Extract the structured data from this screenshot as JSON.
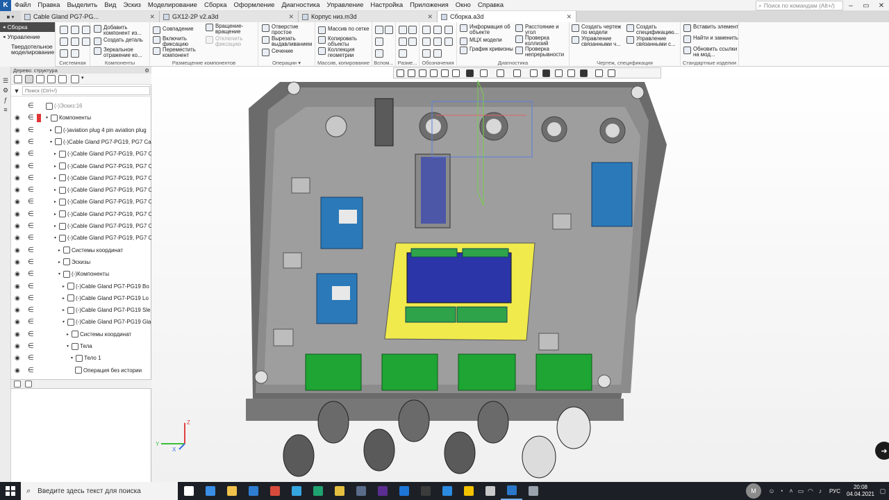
{
  "app": {
    "logo": "K",
    "menu": [
      "Файл",
      "Правка",
      "Выделить",
      "Вид",
      "Эскиз",
      "Моделирование",
      "Сборка",
      "Оформление",
      "Диагностика",
      "Управление",
      "Настройка",
      "Приложения",
      "Окно",
      "Справка"
    ],
    "command_search_placeholder": "Поиск по командам (Alt+/)"
  },
  "tabs": [
    {
      "label": "Cable Gland PG7-PG...",
      "active": false
    },
    {
      "label": "GX12-2P v2.a3d",
      "active": false
    },
    {
      "label": "Корпус низ.m3d",
      "active": false
    },
    {
      "label": "Сборка.a3d",
      "active": true
    }
  ],
  "ribbon": {
    "side_items": [
      "Сборка",
      "Управление",
      "Твердотельное моделирование"
    ],
    "groups": [
      {
        "caption": "Системная",
        "buttons": []
      },
      {
        "caption": "Компоненты",
        "buttons": [
          "Добавить компонент из...",
          "Создать деталь",
          "Зеркальное отражение ко..."
        ]
      },
      {
        "caption": "Размещение компонентов",
        "buttons": [
          "Совпадение",
          "Вращение-вращение",
          "Включить фиксацию",
          "Отключить фиксацию",
          "Переместить компонент"
        ]
      },
      {
        "caption": "Операции",
        "buttons": [
          "Отверстие простое",
          "Вырезать выдавливанием",
          "Сечение"
        ]
      },
      {
        "caption": "Массив, копирование",
        "buttons": [
          "Массив по сетке",
          "Копировать объекты",
          "Коллекция геометрии"
        ]
      },
      {
        "caption": "Вспом...",
        "buttons": []
      },
      {
        "caption": "Разме...",
        "buttons": []
      },
      {
        "caption": "Обозначения",
        "buttons": []
      },
      {
        "caption": "Диагностика",
        "buttons": [
          "Информация об объекте",
          "МЦХ модели",
          "График кривизны",
          "Расстояние и угол",
          "Проверка коллизий",
          "Проверка непрерывности"
        ]
      },
      {
        "caption": "Чертеж, спецификация",
        "buttons": [
          "Создать чертеж по модели",
          "Управление связанными ч...",
          "Создать спецификацию...",
          "Управление связанными с..."
        ]
      },
      {
        "caption": "Стандартные изделия",
        "buttons": [
          "Вставить элемент",
          "Найти и заменить",
          "Обновить ссылки на мод..."
        ]
      }
    ]
  },
  "tree": {
    "header": "Дерево: структура",
    "filter_placeholder": "Поиск (Ctrl+/)",
    "rows": [
      {
        "text": "(-)Эскиз:16",
        "level": 0,
        "expander": "",
        "muted": true,
        "eye": false,
        "error": false
      },
      {
        "text": "Компоненты",
        "level": 0,
        "expander": "▾",
        "muted": false,
        "eye": true,
        "error": true
      },
      {
        "text": "(-)aviation plug 4 pin aviation plug",
        "level": 1,
        "expander": "▸",
        "muted": false,
        "eye": true,
        "error": false
      },
      {
        "text": "(-)Cable Gland PG7-PG19, PG7 Cab",
        "level": 1,
        "expander": "▾",
        "muted": false,
        "eye": true,
        "error": false
      },
      {
        "text": "(-)Cable Gland PG7-PG19, PG7 C",
        "level": 2,
        "expander": "▸",
        "muted": false,
        "eye": true,
        "error": false
      },
      {
        "text": "(-)Cable Gland PG7-PG19, PG7 C",
        "level": 2,
        "expander": "▸",
        "muted": false,
        "eye": true,
        "error": false
      },
      {
        "text": "(-)Cable Gland PG7-PG19, PG7 C",
        "level": 2,
        "expander": "▸",
        "muted": false,
        "eye": true,
        "error": false
      },
      {
        "text": "(-)Cable Gland PG7-PG19, PG7 C",
        "level": 2,
        "expander": "▸",
        "muted": false,
        "eye": true,
        "error": false
      },
      {
        "text": "(-)Cable Gland PG7-PG19, PG7 C",
        "level": 2,
        "expander": "▸",
        "muted": false,
        "eye": true,
        "error": false
      },
      {
        "text": "(-)Cable Gland PG7-PG19, PG7 C",
        "level": 2,
        "expander": "▸",
        "muted": false,
        "eye": true,
        "error": false
      },
      {
        "text": "(-)Cable Gland PG7-PG19, PG7 C",
        "level": 2,
        "expander": "▸",
        "muted": false,
        "eye": true,
        "error": false
      },
      {
        "text": "(-)Cable Gland PG7-PG19, PG7 C",
        "level": 2,
        "expander": "▾",
        "muted": false,
        "eye": true,
        "error": false
      },
      {
        "text": "Системы координат",
        "level": 3,
        "expander": "▸",
        "muted": false,
        "eye": true,
        "error": false
      },
      {
        "text": "Эскизы",
        "level": 3,
        "expander": "▸",
        "muted": false,
        "eye": true,
        "error": false
      },
      {
        "text": "(-)Компоненты",
        "level": 3,
        "expander": "▾",
        "muted": false,
        "eye": true,
        "error": false
      },
      {
        "text": "(-)Cable Gland PG7-PG19 Bo",
        "level": 4,
        "expander": "▸",
        "muted": false,
        "eye": true,
        "error": false
      },
      {
        "text": "(-)Cable Gland PG7-PG19 Lo",
        "level": 4,
        "expander": "▸",
        "muted": false,
        "eye": true,
        "error": false
      },
      {
        "text": "(-)Cable Gland PG7-PG19 Sle",
        "level": 4,
        "expander": "▸",
        "muted": false,
        "eye": true,
        "error": false
      },
      {
        "text": "(-)Cable Gland PG7-PG19 Gla",
        "level": 4,
        "expander": "▾",
        "muted": false,
        "eye": true,
        "error": false
      },
      {
        "text": "Системы координат",
        "level": 5,
        "expander": "▸",
        "muted": false,
        "eye": true,
        "error": false
      },
      {
        "text": "Тела",
        "level": 5,
        "expander": "▾",
        "muted": false,
        "eye": true,
        "error": false
      },
      {
        "text": "Тело 1",
        "level": 6,
        "expander": "▾",
        "muted": false,
        "eye": true,
        "error": false
      },
      {
        "text": "Операция без истории",
        "level": 7,
        "expander": "",
        "muted": false,
        "eye": true,
        "error": false
      }
    ]
  },
  "viewport": {
    "triad": {
      "x": "X",
      "y": "Y",
      "z": "Z"
    }
  },
  "taskbar": {
    "search_placeholder": "Введите здесь текст для поиска",
    "language": "РУС",
    "time": "20:08",
    "date": "04.04.2021",
    "apps": [
      {
        "name": "task-view",
        "color": "#ffffff"
      },
      {
        "name": "store",
        "color": "#3a8ee6"
      },
      {
        "name": "explorer",
        "color": "#f1c24b"
      },
      {
        "name": "mail",
        "color": "#2f7dd1"
      },
      {
        "name": "app-red",
        "color": "#d84a3b"
      },
      {
        "name": "telegram",
        "color": "#35a6e0"
      },
      {
        "name": "edge",
        "color": "#1fa36f"
      },
      {
        "name": "chrome",
        "color": "#e5c040"
      },
      {
        "name": "calculator",
        "color": "#5a6c8a"
      },
      {
        "name": "app-purple",
        "color": "#5c2d91"
      },
      {
        "name": "app-blue",
        "color": "#1e75d8"
      },
      {
        "name": "terminal",
        "color": "#3b3b3b"
      },
      {
        "name": "vscode",
        "color": "#2b8be0"
      },
      {
        "name": "arduino",
        "color": "#f2c200"
      },
      {
        "name": "app-x",
        "color": "#c9c9c9"
      },
      {
        "name": "kompas",
        "color": "#2a77c9"
      },
      {
        "name": "app-gray",
        "color": "#9aa3ad"
      }
    ]
  }
}
